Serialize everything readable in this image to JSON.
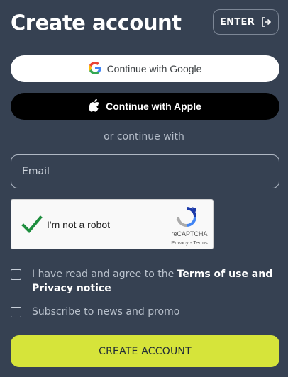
{
  "header": {
    "title": "Create account",
    "enter_label": "ENTER"
  },
  "social": {
    "google_label": "Continue with Google",
    "apple_label": "Continue with Apple"
  },
  "divider_text": "or continue with",
  "form": {
    "email_placeholder": "Email",
    "email_value": ""
  },
  "captcha": {
    "label": "I'm not a robot",
    "brand": "reCAPTCHA",
    "links": "Privacy - Terms",
    "checked": true
  },
  "agreements": {
    "terms_prefix": "I have read and agree to the ",
    "terms_link": "Terms of use and Privacy notice",
    "newsletter_label": "Subscribe to news and promo"
  },
  "submit_label": "CREATE ACCOUNT",
  "colors": {
    "background": "#364152",
    "accent": "#d6e43a",
    "captcha_check": "#1e8e3e"
  }
}
